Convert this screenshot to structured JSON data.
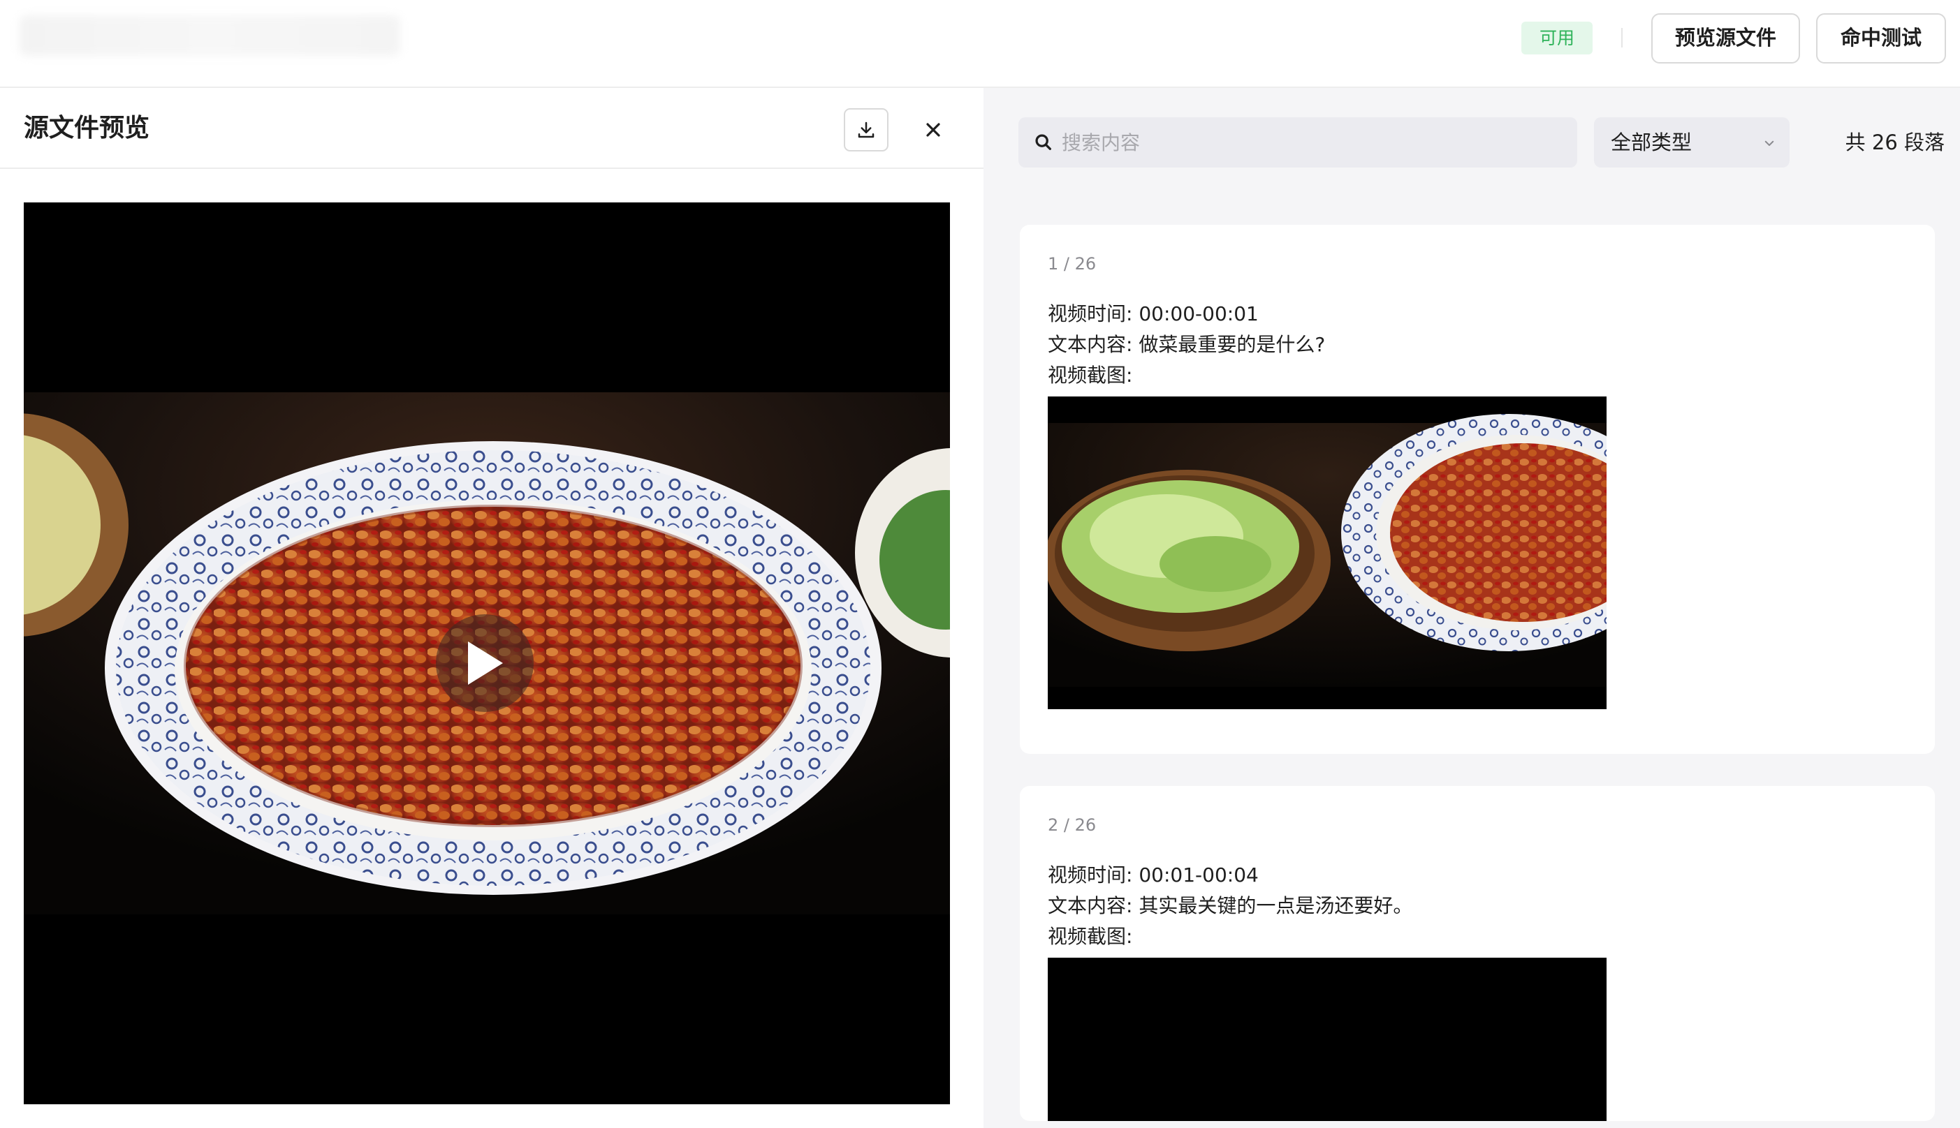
{
  "topbar": {
    "status_badge": "可用",
    "preview_source_label": "预览源文件",
    "hit_test_label": "命中测试"
  },
  "left_panel": {
    "title": "源文件预览",
    "download_icon": "download-icon",
    "close_icon": "close-icon",
    "video": {
      "play_icon": "play-icon"
    }
  },
  "right_panel": {
    "search": {
      "placeholder": "搜索内容",
      "value": "",
      "icon": "search-icon"
    },
    "type_filter": {
      "selected": "全部类型",
      "icon": "chevron-down-icon"
    },
    "segment_count": "共 26 段落",
    "segments": [
      {
        "index": "1 / 26",
        "time_line": "视频时间: 00:00-00:01",
        "text_line": "文本内容: 做菜最重要的是什么?",
        "shot_label": "视频截图:"
      },
      {
        "index": "2 / 26",
        "time_line": "视频时间: 00:01-00:04",
        "text_line": "文本内容: 其实最关键的一点是汤还要好。",
        "shot_label": "视频截图:"
      }
    ]
  },
  "colors": {
    "badge_bg": "#e4f7ea",
    "badge_text": "#2fb35a",
    "right_panel_bg": "#f5f5f7",
    "input_bg": "#ebebf0"
  }
}
